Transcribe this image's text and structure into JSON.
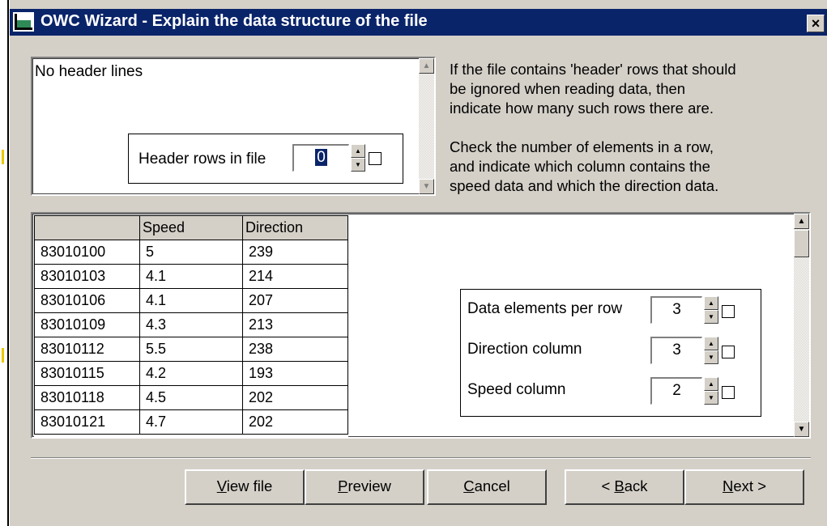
{
  "window": {
    "title": "OWC Wizard - Explain the data structure of the file",
    "close_label": "×",
    "title_bar_color": "#0a246a",
    "face_color": "#d4d0c8"
  },
  "header_section": {
    "preview_text": "No header lines",
    "header_rows_label": "Header rows in file",
    "header_rows_value": "0",
    "header_rows_checked": false
  },
  "instructions": {
    "para1": [
      "If the file contains 'header' rows that should",
      "be ignored when reading data, then",
      "indicate how many such rows there are."
    ],
    "para2": [
      "Check the number of elements in a row,",
      "and indicate which column contains the",
      "speed data and which the direction data."
    ]
  },
  "data_table": {
    "columns": [
      "",
      "Speed",
      "Direction"
    ],
    "rows": [
      [
        "83010100",
        "5",
        "239"
      ],
      [
        "83010103",
        "4.1",
        "214"
      ],
      [
        "83010106",
        "4.1",
        "207"
      ],
      [
        "83010109",
        "4.3",
        "213"
      ],
      [
        "83010112",
        "5.5",
        "238"
      ],
      [
        "83010115",
        "4.2",
        "193"
      ],
      [
        "83010118",
        "4.5",
        "202"
      ],
      [
        "83010121",
        "4.7",
        "202"
      ]
    ]
  },
  "parameters": {
    "elements_per_row_label": "Data elements per row",
    "elements_per_row_value": "3",
    "direction_column_label": "Direction column",
    "direction_column_value": "3",
    "speed_column_label": "Speed column",
    "speed_column_value": "2"
  },
  "buttons": {
    "view_file": {
      "mnemonic": "V",
      "rest": "iew file"
    },
    "preview": {
      "mnemonic": "P",
      "rest": "review"
    },
    "cancel": {
      "mnemonic": "C",
      "rest": "ancel"
    },
    "back": {
      "prefix": "< ",
      "mnemonic": "B",
      "rest": "ack"
    },
    "next": {
      "mnemonic": "N",
      "rest": "ext >"
    }
  },
  "icons": {
    "app": "chart-icon",
    "close": "close-icon",
    "scroll_up": "arrow-up-icon",
    "scroll_down": "arrow-down-icon"
  }
}
